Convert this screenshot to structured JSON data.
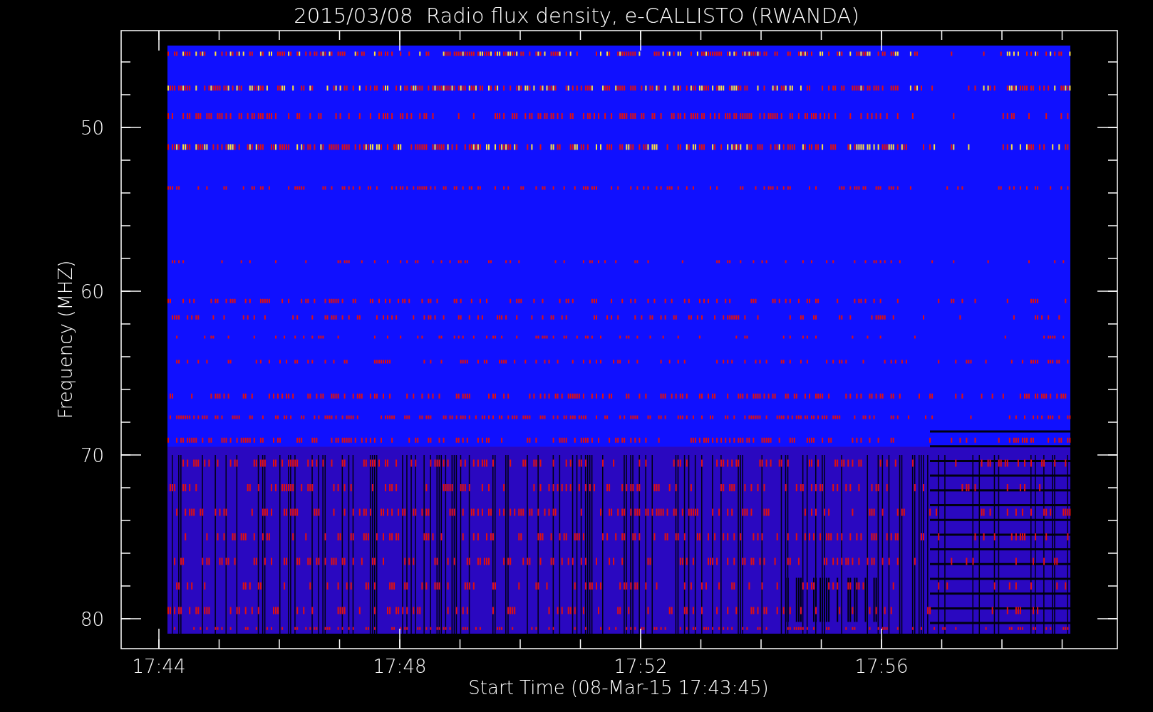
{
  "plot": {
    "title": "2015/03/08  Radio flux density, e-CALLISTO (RWANDA)",
    "xlabel": "Start Time (08-Mar-15 17:43:45)",
    "ylabel": "Frequency (MHZ)",
    "x_tick_labels": [
      "17:44",
      "17:48",
      "17:52",
      "17:56"
    ],
    "y_tick_labels": [
      "50",
      "60",
      "70",
      "80"
    ]
  }
}
